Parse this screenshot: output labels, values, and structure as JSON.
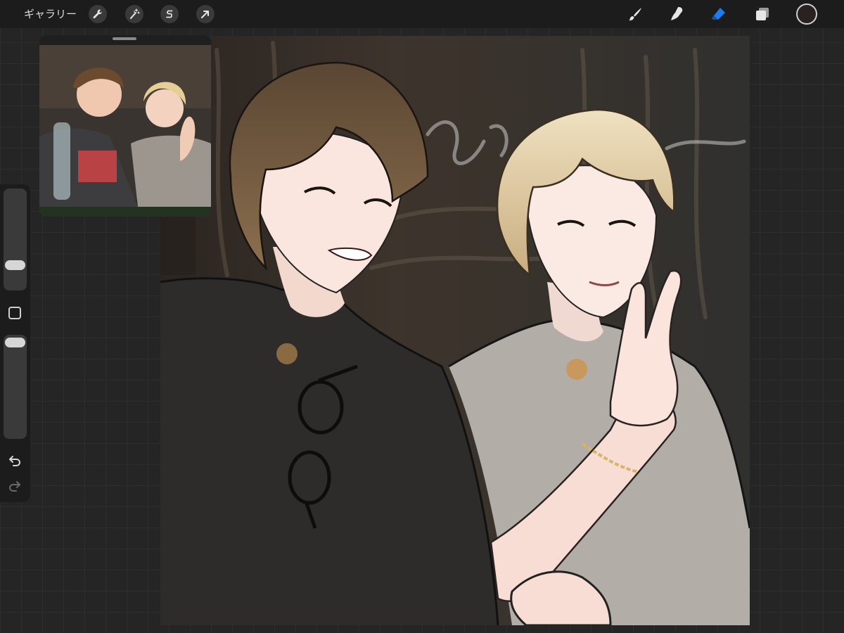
{
  "toolbar": {
    "gallery_label": "ギャラリー",
    "left_tools": [
      {
        "name": "actions",
        "icon": "wrench-icon"
      },
      {
        "name": "adjustments",
        "icon": "magic-wand-icon"
      },
      {
        "name": "selection",
        "icon": "selection-s-icon"
      },
      {
        "name": "transform",
        "icon": "arrow-cursor-icon"
      }
    ],
    "right_tools": [
      {
        "name": "brush",
        "icon": "brush-icon"
      },
      {
        "name": "smudge",
        "icon": "smudge-finger-icon"
      },
      {
        "name": "eraser",
        "icon": "eraser-icon",
        "active": true
      },
      {
        "name": "layers",
        "icon": "layers-icon"
      }
    ],
    "current_color": "#2a2220",
    "active_tool_color": "#1e7cf0"
  },
  "sidebar": {
    "brush_size_icon": "slider-thumb",
    "modify_icon": "square-modify-icon",
    "undo_icon": "undo-arrow-icon",
    "redo_icon": "redo-arrow-icon"
  },
  "reference": {
    "icon": "reference-photo"
  }
}
